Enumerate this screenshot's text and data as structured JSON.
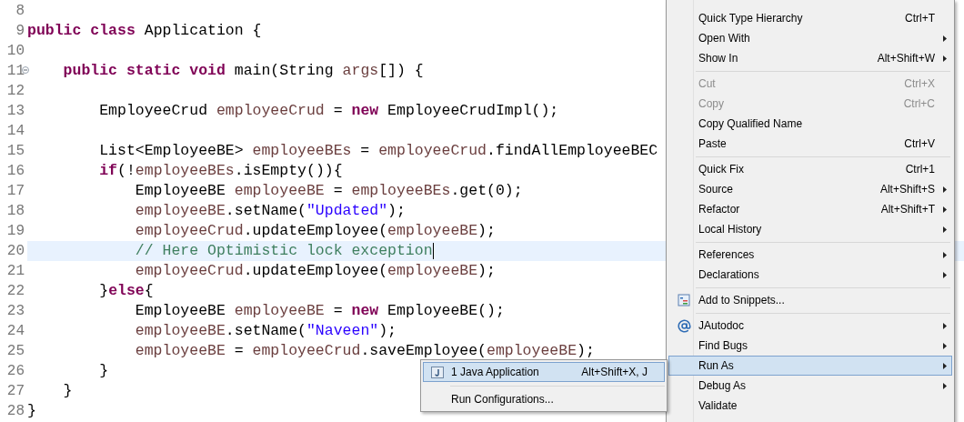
{
  "editor": {
    "lines": [
      {
        "number": "8",
        "fold": false,
        "current": false
      },
      {
        "number": "9",
        "fold": false,
        "current": false,
        "tokens": [
          {
            "kind": "keyword",
            "text": "public "
          },
          {
            "kind": "keyword",
            "text": "class"
          },
          {
            "kind": "plain",
            "text": " Application {"
          }
        ]
      },
      {
        "number": "10",
        "fold": false,
        "current": false
      },
      {
        "number": "11",
        "fold": true,
        "current": false,
        "tokens": [
          {
            "kind": "keyword",
            "text": "    public "
          },
          {
            "kind": "keyword",
            "text": "static "
          },
          {
            "kind": "keyword",
            "text": "void"
          },
          {
            "kind": "plain",
            "text": " main(String "
          },
          {
            "kind": "variable",
            "text": "args"
          },
          {
            "kind": "plain",
            "text": "[]) {"
          }
        ]
      },
      {
        "number": "12",
        "fold": false,
        "current": false
      },
      {
        "number": "13",
        "fold": false,
        "current": false,
        "tokens": [
          {
            "kind": "plain",
            "text": "        EmployeeCrud "
          },
          {
            "kind": "variable",
            "text": "employeeCrud"
          },
          {
            "kind": "plain",
            "text": " = "
          },
          {
            "kind": "keyword",
            "text": "new"
          },
          {
            "kind": "plain",
            "text": " EmployeeCrudImpl();"
          }
        ]
      },
      {
        "number": "14",
        "fold": false,
        "current": false
      },
      {
        "number": "15",
        "fold": false,
        "current": false,
        "tokens": [
          {
            "kind": "plain",
            "text": "        List<EmployeeBE> "
          },
          {
            "kind": "variable",
            "text": "employeeBEs"
          },
          {
            "kind": "plain",
            "text": " = "
          },
          {
            "kind": "variable",
            "text": "employeeCrud"
          },
          {
            "kind": "plain",
            "text": ".findAllEmployeeBEC"
          }
        ]
      },
      {
        "number": "16",
        "fold": false,
        "current": false,
        "tokens": [
          {
            "kind": "keyword",
            "text": "        if"
          },
          {
            "kind": "plain",
            "text": "(!"
          },
          {
            "kind": "variable",
            "text": "employeeBEs"
          },
          {
            "kind": "plain",
            "text": ".isEmpty()){"
          }
        ]
      },
      {
        "number": "17",
        "fold": false,
        "current": false,
        "tokens": [
          {
            "kind": "plain",
            "text": "            EmployeeBE "
          },
          {
            "kind": "variable",
            "text": "employeeBE"
          },
          {
            "kind": "plain",
            "text": " = "
          },
          {
            "kind": "variable",
            "text": "employeeBEs"
          },
          {
            "kind": "plain",
            "text": ".get(0);"
          }
        ]
      },
      {
        "number": "18",
        "fold": false,
        "current": false,
        "tokens": [
          {
            "kind": "variable",
            "text": "            employeeBE"
          },
          {
            "kind": "plain",
            "text": ".setName("
          },
          {
            "kind": "string",
            "text": "\"Updated\""
          },
          {
            "kind": "plain",
            "text": ");"
          }
        ]
      },
      {
        "number": "19",
        "fold": false,
        "current": false,
        "tokens": [
          {
            "kind": "variable",
            "text": "            employeeCrud"
          },
          {
            "kind": "plain",
            "text": ".updateEmployee("
          },
          {
            "kind": "variable",
            "text": "employeeBE"
          },
          {
            "kind": "plain",
            "text": ");"
          }
        ]
      },
      {
        "number": "20",
        "fold": false,
        "current": true,
        "tokens": [
          {
            "kind": "comment",
            "text": "            // Here Optimistic lock exception"
          }
        ]
      },
      {
        "number": "21",
        "fold": false,
        "current": false,
        "tokens": [
          {
            "kind": "variable",
            "text": "            employeeCrud"
          },
          {
            "kind": "plain",
            "text": ".updateEmployee("
          },
          {
            "kind": "variable",
            "text": "employeeBE"
          },
          {
            "kind": "plain",
            "text": ");"
          }
        ]
      },
      {
        "number": "22",
        "fold": false,
        "current": false,
        "tokens": [
          {
            "kind": "plain",
            "text": "        }"
          },
          {
            "kind": "keyword",
            "text": "else"
          },
          {
            "kind": "plain",
            "text": "{"
          }
        ]
      },
      {
        "number": "23",
        "fold": false,
        "current": false,
        "tokens": [
          {
            "kind": "plain",
            "text": "            EmployeeBE "
          },
          {
            "kind": "variable",
            "text": "employeeBE"
          },
          {
            "kind": "plain",
            "text": " = "
          },
          {
            "kind": "keyword",
            "text": "new"
          },
          {
            "kind": "plain",
            "text": " EmployeeBE();"
          }
        ]
      },
      {
        "number": "24",
        "fold": false,
        "current": false,
        "tokens": [
          {
            "kind": "variable",
            "text": "            employeeBE"
          },
          {
            "kind": "plain",
            "text": ".setName("
          },
          {
            "kind": "string",
            "text": "\"Naveen\""
          },
          {
            "kind": "plain",
            "text": ");"
          }
        ]
      },
      {
        "number": "25",
        "fold": false,
        "current": false,
        "tokens": [
          {
            "kind": "variable",
            "text": "            employeeBE"
          },
          {
            "kind": "plain",
            "text": " = "
          },
          {
            "kind": "variable",
            "text": "employeeCrud"
          },
          {
            "kind": "plain",
            "text": ".saveEmployee("
          },
          {
            "kind": "variable",
            "text": "employeeBE"
          },
          {
            "kind": "plain",
            "text": ");"
          }
        ]
      },
      {
        "number": "26",
        "fold": false,
        "current": false,
        "tokens": [
          {
            "kind": "plain",
            "text": "        }"
          }
        ]
      },
      {
        "number": "27",
        "fold": false,
        "current": false,
        "tokens": [
          {
            "kind": "plain",
            "text": "    }"
          }
        ]
      },
      {
        "number": "28",
        "fold": false,
        "current": false,
        "tokens": [
          {
            "kind": "plain",
            "text": "}"
          }
        ]
      }
    ]
  },
  "context_menu": {
    "items": [
      {
        "kind": "item",
        "label": "Quick Type Hierarchy",
        "shortcut": "Ctrl+T",
        "submenu": false,
        "disabled": false,
        "selected": false
      },
      {
        "kind": "item",
        "label": "Open With",
        "submenu": true,
        "disabled": false,
        "selected": false
      },
      {
        "kind": "item",
        "label": "Show In",
        "shortcut": "Alt+Shift+W",
        "submenu": true,
        "disabled": false,
        "selected": false
      },
      {
        "kind": "separator"
      },
      {
        "kind": "item",
        "label": "Cut",
        "shortcut": "Ctrl+X",
        "submenu": false,
        "disabled": true,
        "selected": false
      },
      {
        "kind": "item",
        "label": "Copy",
        "shortcut": "Ctrl+C",
        "submenu": false,
        "disabled": true,
        "selected": false
      },
      {
        "kind": "item",
        "label": "Copy Qualified Name",
        "submenu": false,
        "disabled": false,
        "selected": false
      },
      {
        "kind": "item",
        "label": "Paste",
        "shortcut": "Ctrl+V",
        "submenu": false,
        "disabled": false,
        "selected": false
      },
      {
        "kind": "separator"
      },
      {
        "kind": "item",
        "label": "Quick Fix",
        "shortcut": "Ctrl+1",
        "submenu": false,
        "disabled": false,
        "selected": false
      },
      {
        "kind": "item",
        "label": "Source",
        "shortcut": "Alt+Shift+S",
        "submenu": true,
        "disabled": false,
        "selected": false
      },
      {
        "kind": "item",
        "label": "Refactor",
        "shortcut": "Alt+Shift+T",
        "submenu": true,
        "disabled": false,
        "selected": false
      },
      {
        "kind": "item",
        "label": "Local History",
        "submenu": true,
        "disabled": false,
        "selected": false
      },
      {
        "kind": "separator"
      },
      {
        "kind": "item",
        "label": "References",
        "submenu": true,
        "disabled": false,
        "selected": false
      },
      {
        "kind": "item",
        "label": "Declarations",
        "submenu": true,
        "disabled": false,
        "selected": false
      },
      {
        "kind": "separator"
      },
      {
        "kind": "item",
        "label": "Add to Snippets...",
        "submenu": false,
        "disabled": false,
        "selected": false
      },
      {
        "kind": "separator"
      },
      {
        "kind": "item",
        "label": "JAutodoc",
        "submenu": true,
        "disabled": false,
        "selected": false
      },
      {
        "kind": "item",
        "label": "Find Bugs",
        "submenu": true,
        "disabled": false,
        "selected": false
      },
      {
        "kind": "item",
        "label": "Run As",
        "submenu": true,
        "disabled": false,
        "selected": true
      },
      {
        "kind": "item",
        "label": "Debug As",
        "submenu": true,
        "disabled": false,
        "selected": false
      },
      {
        "kind": "item",
        "label": "Validate",
        "submenu": false,
        "disabled": false,
        "selected": false
      }
    ]
  },
  "run_as_submenu": {
    "items": [
      {
        "kind": "item",
        "label": "1 Java Application",
        "shortcut": "Alt+Shift+X, J",
        "selected": true
      },
      {
        "kind": "separator"
      },
      {
        "kind": "item",
        "label": "Run Configurations...",
        "selected": false
      }
    ]
  }
}
